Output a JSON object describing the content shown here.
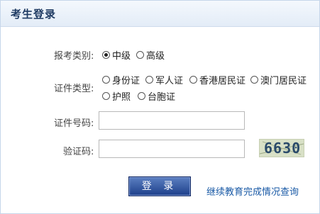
{
  "header": {
    "title": "考生登录"
  },
  "form": {
    "category_label": "报考类别:",
    "category_options": [
      {
        "label": "中级",
        "checked": true
      },
      {
        "label": "高级",
        "checked": false
      }
    ],
    "id_type_label": "证件类型:",
    "id_type_options": [
      {
        "label": "身份证",
        "checked": false
      },
      {
        "label": "军人证",
        "checked": false
      },
      {
        "label": "香港居民证",
        "checked": false
      },
      {
        "label": "澳门居民证",
        "checked": false
      },
      {
        "label": "护照",
        "checked": false
      },
      {
        "label": "台胞证",
        "checked": false
      }
    ],
    "id_number_label": "证件号码:",
    "id_number_value": "",
    "captcha_label": "验证码:",
    "captcha_value": "",
    "captcha_image_text": "6630"
  },
  "actions": {
    "login_label": "登 录",
    "continuing_edu_link": "继续教育完成情况查询"
  },
  "colors": {
    "header_text": "#1f3b63",
    "link": "#1a5aa6",
    "button": "#1d3f8a"
  }
}
